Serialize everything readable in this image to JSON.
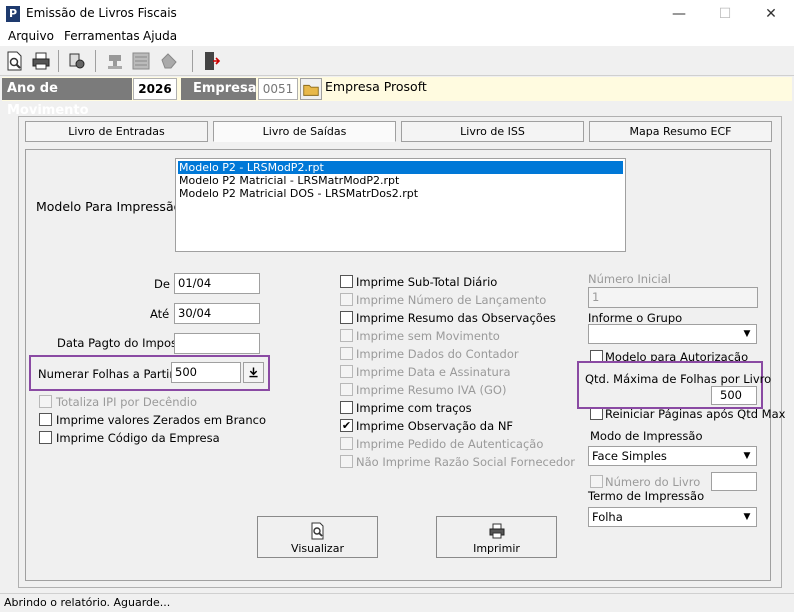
{
  "window": {
    "title": "Emissão de Livros Fiscais",
    "app_icon_letter": "P",
    "minimize": "—",
    "maximize": "☐",
    "close": "✕"
  },
  "menu": [
    "Arquivo",
    "Ferramentas",
    "Ajuda"
  ],
  "toolbar": {
    "icons": [
      "preview-icon",
      "print-icon",
      "config-icon",
      "stamp-icon",
      "document-icon",
      "hand-icon",
      "exit-door-icon"
    ]
  },
  "header": {
    "ano_label": "Ano de Movimento",
    "ano_value": "2026",
    "empresa_label": "Empresa",
    "empresa_code": "0051",
    "empresa_name": "Empresa Prosoft"
  },
  "tabs": [
    {
      "label": "Livro de Entradas",
      "active": false
    },
    {
      "label": "Livro de Saídas",
      "active": true
    },
    {
      "label": "Livro de ISS",
      "active": false
    },
    {
      "label": "Mapa Resumo ECF",
      "active": false
    }
  ],
  "modelo": {
    "label": "Modelo Para Impressão",
    "options": [
      {
        "text": "Modelo P2 - LRSModP2.rpt",
        "selected": true
      },
      {
        "text": "Modelo P2 Matricial - LRSMatrModP2.rpt",
        "selected": false
      },
      {
        "text": "Modelo P2 Matricial DOS - LRSMatrDos2.rpt",
        "selected": false
      }
    ]
  },
  "left": {
    "de_label": "De",
    "de_value": "01/04",
    "ate_label": "Até",
    "ate_value": "30/04",
    "data_pagto_label": "Data Pagto do Imposto",
    "data_pagto_value": "",
    "numerar_label": "Numerar Folhas a Partir de",
    "numerar_value": "500",
    "checks": [
      {
        "label": "Totaliza IPI por Decêndio",
        "checked": false,
        "enabled": false
      },
      {
        "label": "Imprime valores Zerados em Branco",
        "checked": false,
        "enabled": true
      },
      {
        "label": "Imprime Código da Empresa",
        "checked": false,
        "enabled": true
      }
    ]
  },
  "middle": {
    "checks": [
      {
        "label": "Imprime Sub-Total Diário",
        "checked": false,
        "enabled": true
      },
      {
        "label": "Imprime Número de Lançamento",
        "checked": false,
        "enabled": false
      },
      {
        "label": "Imprime Resumo das Observações",
        "checked": false,
        "enabled": true
      },
      {
        "label": "Imprime sem Movimento",
        "checked": false,
        "enabled": false
      },
      {
        "label": "Imprime Dados do Contador",
        "checked": false,
        "enabled": false
      },
      {
        "label": "Imprime Data e Assinatura",
        "checked": false,
        "enabled": false
      },
      {
        "label": "Imprime Resumo IVA (GO)",
        "checked": false,
        "enabled": false
      },
      {
        "label": "Imprime com traços",
        "checked": false,
        "enabled": true
      },
      {
        "label": "Imprime Observação da NF",
        "checked": true,
        "enabled": true
      },
      {
        "label": "Imprime Pedido de Autenticação",
        "checked": false,
        "enabled": false
      },
      {
        "label": "Não Imprime Razão Social Fornecedor",
        "checked": false,
        "enabled": false
      }
    ]
  },
  "right": {
    "numero_inicial_label": "Número Inicial",
    "numero_inicial_value": "1",
    "informe_grupo_label": "Informe o Grupo",
    "informe_grupo_value": "",
    "modelo_autorizacao_label": "Modelo para Autorização",
    "qtd_maxima_label": "Qtd. Máxima de Folhas por Livro",
    "qtd_maxima_value": "500",
    "reiniciar_label": "Reiniciar Páginas após Qtd Max",
    "modo_impressao_label": "Modo de Impressão",
    "modo_impressao_value": "Face Simples",
    "numero_livro_label": "Número do Livro",
    "numero_livro_value": "",
    "termo_impressao_label": "Termo de Impressão",
    "termo_impressao_value": "Folha"
  },
  "buttons": {
    "visualizar": "Visualizar",
    "imprimir": "Imprimir"
  },
  "status": "Abrindo o relatório. Aguarde...",
  "colors": {
    "selection": "#0078d7",
    "highlight_box": "#8a4aa3",
    "header_label_bg": "#7b7b7b",
    "header_strip_bg": "#fffbe0"
  }
}
